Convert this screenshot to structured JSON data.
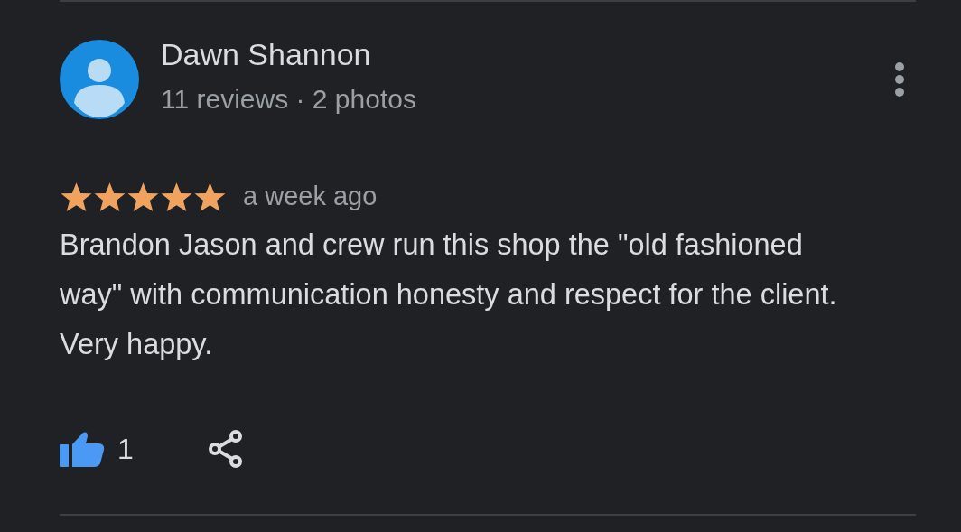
{
  "review": {
    "author": "Dawn Shannon",
    "author_meta": "11 reviews · 2 photos",
    "stars": 5,
    "time": "a week ago",
    "text": "Brandon Jason and crew run this shop the \"old fashioned way\" with communication honesty and respect for the client. Very happy.",
    "liked": true,
    "like_count": "1"
  }
}
